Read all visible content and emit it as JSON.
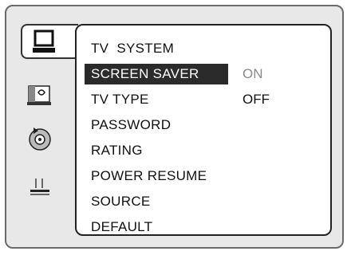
{
  "sidebar": {
    "icons": [
      {
        "name": "tv-monitor-icon",
        "active": true
      },
      {
        "name": "audio-icon",
        "active": false
      },
      {
        "name": "disc-icon",
        "active": false
      },
      {
        "name": "preference-icon",
        "active": false
      }
    ]
  },
  "menu": {
    "items": [
      {
        "label": "TV  SYSTEM",
        "value": "",
        "selected": false
      },
      {
        "label": "SCREEN SAVER",
        "value": "ON",
        "selected": true
      },
      {
        "label": "TV TYPE",
        "value": "OFF",
        "selected": false
      },
      {
        "label": "PASSWORD",
        "value": "",
        "selected": false
      },
      {
        "label": "RATING",
        "value": "",
        "selected": false
      },
      {
        "label": "POWER RESUME",
        "value": "",
        "selected": false
      },
      {
        "label": "SOURCE",
        "value": "",
        "selected": false
      },
      {
        "label": "DEFAULT",
        "value": "",
        "selected": false
      }
    ]
  },
  "colors": {
    "highlight": "#2b2b2b",
    "highlight_text": "#ffffff",
    "dim_value": "#8a8a8a"
  }
}
